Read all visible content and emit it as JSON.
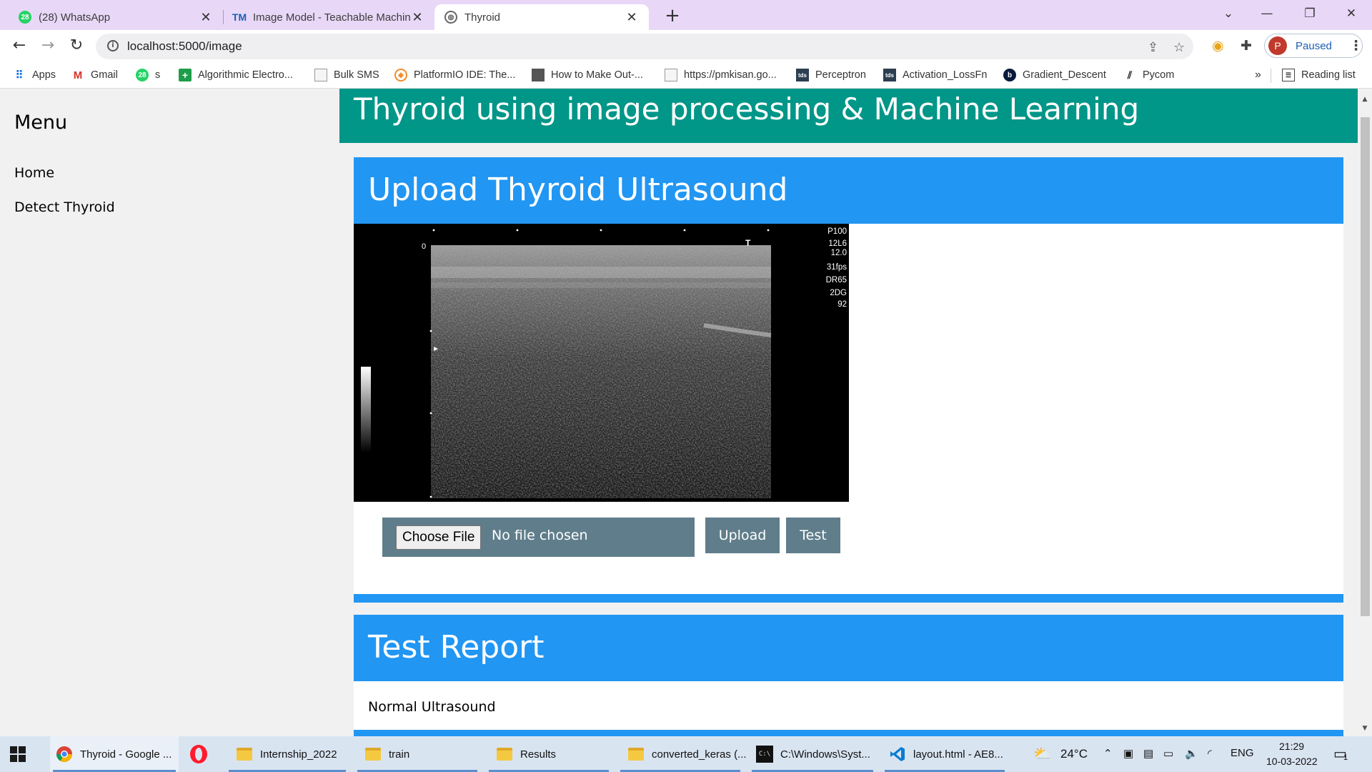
{
  "browser": {
    "tabs": [
      {
        "title": "(28) WhatsApp",
        "badge": "28"
      },
      {
        "title": "Image Model - Teachable Machin",
        "badge": "TM"
      },
      {
        "title": "Thyroid",
        "badge": ""
      }
    ],
    "url": "localhost:5000/image",
    "profile_initial": "P",
    "profile_status": "Paused",
    "reading_list": "Reading list",
    "bookmarks": [
      {
        "label": "Apps"
      },
      {
        "label": "Gmail"
      },
      {
        "label": "s",
        "badge": "28"
      },
      {
        "label": "Algorithmic Electro..."
      },
      {
        "label": "Bulk SMS"
      },
      {
        "label": "PlatformIO IDE: The..."
      },
      {
        "label": "How to Make Out-..."
      },
      {
        "label": "https://pmkisan.go..."
      },
      {
        "label": "Perceptron",
        "badge": "tds"
      },
      {
        "label": "Activation_LossFn",
        "badge": "tds"
      },
      {
        "label": "Gradient_Descent",
        "badge": "b"
      },
      {
        "label": "Pycom"
      }
    ]
  },
  "page": {
    "sidebar": {
      "title": "Menu",
      "items": [
        {
          "label": "Home"
        },
        {
          "label": "Detect Thyroid"
        }
      ]
    },
    "header_title": "Thyroid using image processing & Machine Learning",
    "upload": {
      "title": "Upload Thyroid Ultrasound",
      "choose_label": "Choose File",
      "no_file_text": "No file chosen",
      "upload_label": "Upload",
      "test_label": "Test"
    },
    "ultrasound": {
      "depth_zero": "0",
      "marker": "T",
      "params": [
        "P100",
        "12L6",
        "12.0",
        "31fps",
        "DR65",
        "2DG",
        "92"
      ]
    },
    "report": {
      "title": "Test Report",
      "result": "Normal Ultrasound"
    }
  },
  "taskbar": {
    "items": [
      {
        "label": "Thyroid - Google ..."
      },
      {
        "label": ""
      },
      {
        "label": "Internship_2022"
      },
      {
        "label": "train"
      },
      {
        "label": "Results"
      },
      {
        "label": "converted_keras (..."
      },
      {
        "label": "C:\\Windows\\Syst..."
      },
      {
        "label": "layout.html - AE8..."
      }
    ],
    "temperature": "24°C",
    "language": "ENG",
    "time": "21:29",
    "date": "10-03-2022",
    "notification_count": "1"
  },
  "colors": {
    "header": "#009688",
    "card_header": "#2196f3",
    "button": "#607d8b",
    "tabstrip": "#e8d7f7"
  }
}
